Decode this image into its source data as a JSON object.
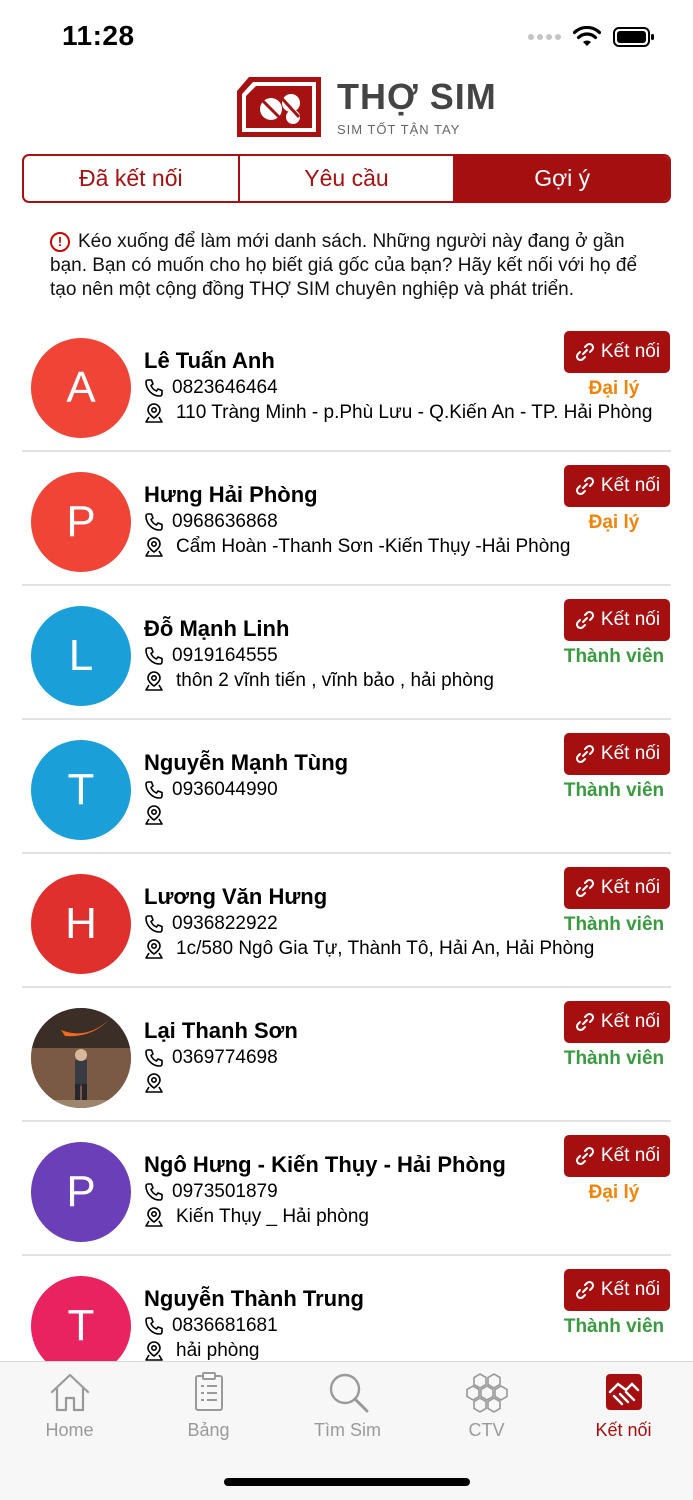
{
  "status": {
    "time": "11:28"
  },
  "logo": {
    "title": "THỢ SIM",
    "subtitle": "SIM TỐT TẬN TAY"
  },
  "tabs": [
    {
      "label": "Đã kết nối",
      "active": false
    },
    {
      "label": "Yêu cầu",
      "active": false
    },
    {
      "label": "Gợi ý",
      "active": true
    }
  ],
  "info_text": "Kéo xuống để làm mới danh sách. Những người này đang ở gần bạn. Bạn có muốn cho họ biết giá gốc của bạn? Hãy kết nối với họ để tạo nên một cộng đồng THỢ SIM chuyên nghiệp và phát triển.",
  "connect_label": "Kết nối",
  "contacts": [
    {
      "initial": "A",
      "color": "#f04437",
      "name": "Lê Tuấn Anh",
      "phone": "0823646464",
      "address": "110 Tràng Minh - p.Phù Lưu - Q.Kiến An - TP. Hải Phòng",
      "role": "Đại lý",
      "role_type": "agent"
    },
    {
      "initial": "P",
      "color": "#f04437",
      "name": "Hưng Hải Phòng",
      "phone": "0968636868",
      "address": "Cẩm Hoàn -Thanh Sơn -Kiến Thụy -Hải Phòng",
      "role": "Đại lý",
      "role_type": "agent"
    },
    {
      "initial": "L",
      "color": "#1a9fd8",
      "name": "Đỗ Mạnh Linh",
      "phone": "0919164555",
      "address": "thôn 2 vĩnh tiến , vĩnh bảo , hải phòng",
      "role": "Thành viên",
      "role_type": "member"
    },
    {
      "initial": "T",
      "color": "#1a9fd8",
      "name": "Nguyễn Mạnh Tùng",
      "phone": "0936044990",
      "address": "",
      "role": "Thành viên",
      "role_type": "member"
    },
    {
      "initial": "H",
      "color": "#e0302e",
      "name": "Lương Văn Hưng",
      "phone": "0936822922",
      "address": "1c/580 Ngô Gia Tự, Thành Tô, Hải An, Hải Phòng",
      "role": "Thành viên",
      "role_type": "member"
    },
    {
      "initial": "",
      "color": "#8a6a50",
      "photo": true,
      "name": "Lại Thanh Sơn",
      "phone": "0369774698",
      "address": "",
      "role": "Thành viên",
      "role_type": "member"
    },
    {
      "initial": "P",
      "color": "#6b3fb8",
      "name": "Ngô Hưng -  Kiến Thụy - Hải Phòng",
      "phone": "0973501879",
      "address": "Kiến Thụy _ Hải phòng",
      "role": "Đại lý",
      "role_type": "agent"
    },
    {
      "initial": "T",
      "color": "#e8235f",
      "name": "Nguyễn Thành Trung",
      "phone": "0836681681",
      "address": "hải phòng",
      "role": "Thành viên",
      "role_type": "member"
    }
  ],
  "tabbar": [
    {
      "label": "Home",
      "icon": "home-icon",
      "active": false
    },
    {
      "label": "Bảng",
      "icon": "clipboard-icon",
      "active": false
    },
    {
      "label": "Tìm Sim",
      "icon": "search-icon",
      "active": false
    },
    {
      "label": "CTV",
      "icon": "hexagon-cluster-icon",
      "active": false
    },
    {
      "label": "Kết nối",
      "icon": "handshake-icon",
      "active": true
    }
  ],
  "colors": {
    "brand": "#a60f0f",
    "agent": "#f0850b",
    "member": "#3a9a3f"
  }
}
